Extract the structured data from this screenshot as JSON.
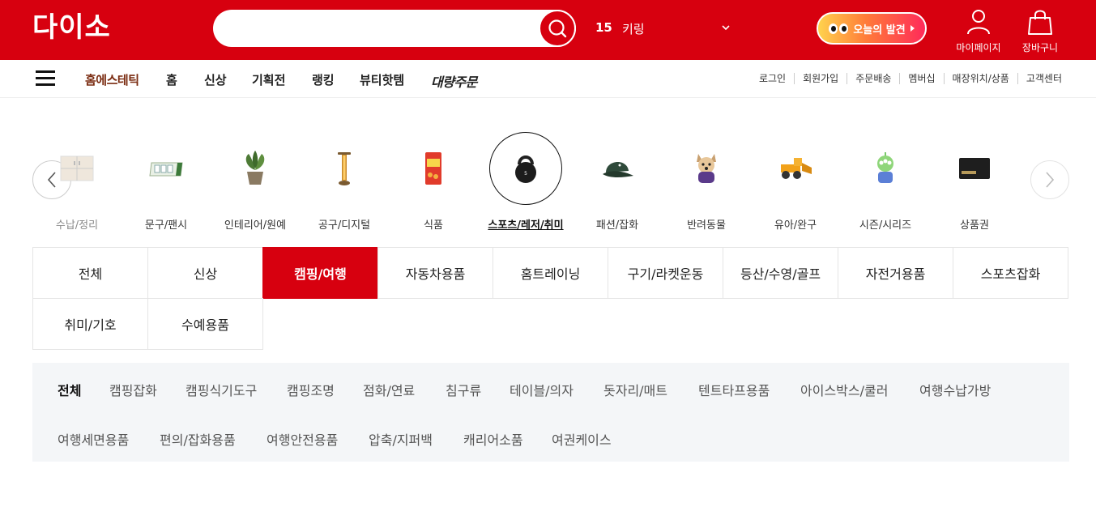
{
  "header": {
    "logo": "다이소",
    "search_placeholder": "",
    "rank_number": "15",
    "rank_keyword": "키링",
    "discover_label": "오늘의 발견",
    "mypage_label": "마이페이지",
    "cart_label": "장바구니",
    "brand_color": "#d7000f"
  },
  "nav": {
    "items": [
      "홈에스테틱",
      "홈",
      "신상",
      "기획전",
      "랭킹",
      "뷰티핫템",
      "대량주문"
    ],
    "utility": [
      "로그인",
      "회원가입",
      "주문배송",
      "멤버십",
      "매장위치/상품",
      "고객센터"
    ]
  },
  "categories": [
    {
      "label": "수납/정리",
      "icon": "storage-icon"
    },
    {
      "label": "문구/팬시",
      "icon": "stationery-icon"
    },
    {
      "label": "인테리어/원예",
      "icon": "plant-icon"
    },
    {
      "label": "공구/디지털",
      "icon": "lamp-icon"
    },
    {
      "label": "식품",
      "icon": "snack-icon"
    },
    {
      "label": "스포츠/레저/취미",
      "icon": "kettlebell-icon",
      "active": true
    },
    {
      "label": "패션/잡화",
      "icon": "cap-icon"
    },
    {
      "label": "반려동물",
      "icon": "dog-icon"
    },
    {
      "label": "유아/완구",
      "icon": "toy-truck-icon"
    },
    {
      "label": "시즌/시리즈",
      "icon": "alien-doll-icon"
    },
    {
      "label": "상품권",
      "icon": "gift-card-icon"
    }
  ],
  "sub_categories": {
    "items": [
      "전체",
      "신상",
      "캠핑/여행",
      "자동차용품",
      "홈트레이닝",
      "구기/라켓운동",
      "등산/수영/골프",
      "자전거용품",
      "스포츠잡화",
      "취미/기호",
      "수예용품"
    ],
    "active": "캠핑/여행"
  },
  "detail_categories": {
    "items": [
      "전체",
      "캠핑잡화",
      "캠핑식기도구",
      "캠핑조명",
      "점화/연료",
      "침구류",
      "테이블/의자",
      "돗자리/매트",
      "텐트타프용품",
      "아이스박스/쿨러",
      "여행수납가방",
      "여행세면용품",
      "편의/잡화용품",
      "여행안전용품",
      "압축/지퍼백",
      "캐리어소품",
      "여권케이스"
    ],
    "active": "전체"
  }
}
